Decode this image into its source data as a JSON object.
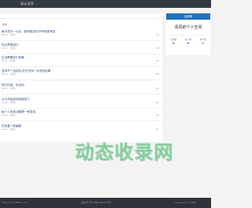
{
  "header": {
    "site_title": "碧云境界"
  },
  "main": {
    "section_label": "最新",
    "posts": [
      {
        "title": "每天进步一点点，越来越自信不停地探索自",
        "meta": "admin · 1天前",
        "date": "0/0"
      },
      {
        "title": "但为梦想而已",
        "meta": "admin · 3天前",
        "date": "0/0"
      },
      {
        "title": "生活需要你们来解",
        "meta": "admin · 4天前",
        "date": "0/0"
      },
      {
        "title": "坚持不一定成功,但不坚持一定没有结果",
        "meta": "admin · 5天前",
        "date": "0/0"
      },
      {
        "title": "努力向前，永远向",
        "meta": "admin · 6天前",
        "date": "0/0"
      },
      {
        "title": "从今开始真的就做到了",
        "meta": "admin · 7天前",
        "date": "0/0"
      },
      {
        "title": "每个人的成功都是一种坚持",
        "meta": "admin · 8天前",
        "date": "0/0"
      },
      {
        "title": "先完善一种编程",
        "meta": "admin · 9天前",
        "date": "0/0"
      }
    ]
  },
  "sidebar": {
    "head": "活跃榜",
    "space_name": "清风的个人空间",
    "stats": [
      {
        "label": "主题数",
        "value": "8"
      },
      {
        "label": "帖子数",
        "value": "8"
      },
      {
        "label": "用户数",
        "value": "1"
      }
    ]
  },
  "footer": {
    "left": "Powered by BBS 4.0.4",
    "center": "备案号:京ICP备0000000号-1",
    "right": "Processed: 0.008s"
  },
  "watermark": {
    "text": "动态收录网"
  }
}
